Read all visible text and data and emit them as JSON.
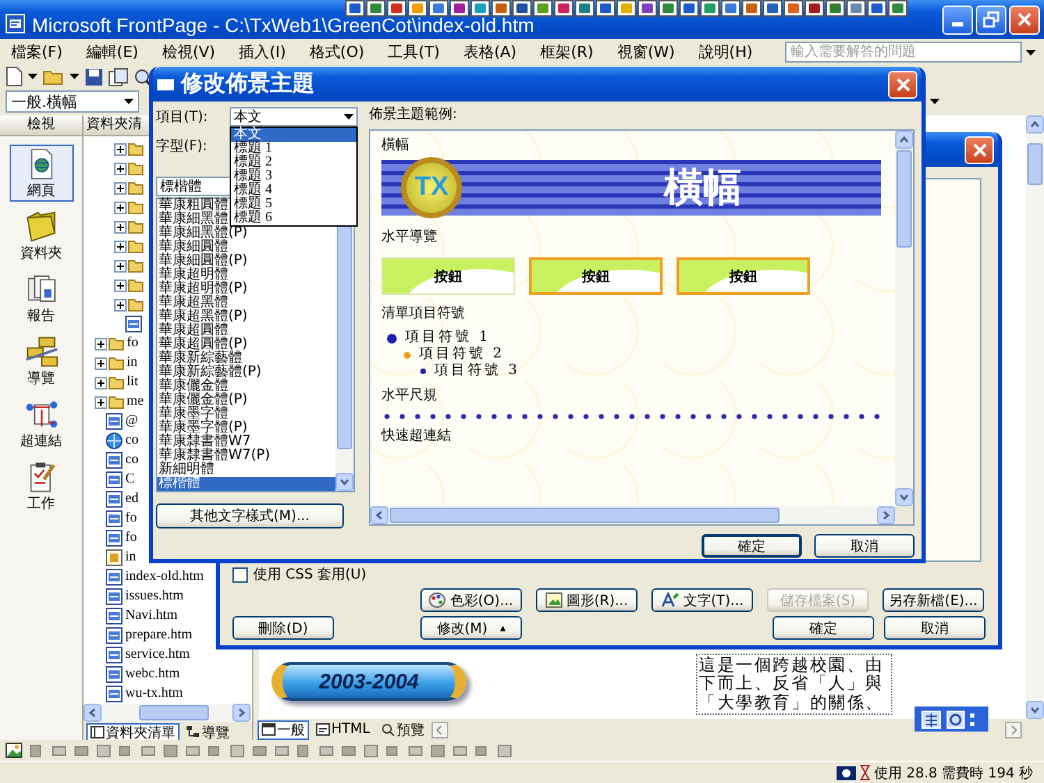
{
  "window": {
    "title": "Microsoft FrontPage - C:\\TxWeb1\\GreenCot\\index-old.htm"
  },
  "menu": [
    "檔案(F)",
    "編輯(E)",
    "檢視(V)",
    "插入(I)",
    "格式(O)",
    "工具(T)",
    "表格(A)",
    "框架(R)",
    "視窗(W)",
    "說明(H)"
  ],
  "help_box": {
    "placeholder": "輸入需要解答的問題"
  },
  "style_box": {
    "value": "一般.橫幅"
  },
  "views_bar": {
    "header": "檢視",
    "items": [
      {
        "label": "網頁",
        "kind": "page",
        "selected": true
      },
      {
        "label": "資料夾",
        "kind": "folders",
        "selected": false
      },
      {
        "label": "報告",
        "kind": "reports",
        "selected": false
      },
      {
        "label": "導覽",
        "kind": "navigation",
        "selected": false
      },
      {
        "label": "超連結",
        "kind": "hyperlinks",
        "selected": false
      },
      {
        "label": "工作",
        "kind": "tasks",
        "selected": false
      }
    ]
  },
  "folder_list": {
    "header": "資料夾清",
    "items": [
      {
        "children": [
          {
            "kind": "folder",
            "expanded": false
          },
          {
            "kind": "folder",
            "expanded": false
          },
          {
            "kind": "folder",
            "expanded": false
          },
          {
            "kind": "folder",
            "expanded": false
          },
          {
            "kind": "folder",
            "expanded": false
          },
          {
            "kind": "folder",
            "expanded": false
          },
          {
            "kind": "folder",
            "expanded": false
          },
          {
            "kind": "folder",
            "expanded": false
          },
          {
            "kind": "folder",
            "expanded": false
          },
          {
            "kind": "page"
          }
        ]
      },
      {
        "kind": "folder",
        "label": "fo",
        "expanded": false
      },
      {
        "kind": "folder",
        "label": "in",
        "expanded": false
      },
      {
        "kind": "folder",
        "label": "lit",
        "expanded": false
      },
      {
        "kind": "folder",
        "label": "me",
        "expanded": false
      },
      {
        "kind": "page",
        "label": "@"
      },
      {
        "kind": "globe",
        "label": "co"
      },
      {
        "kind": "page",
        "label": "co"
      },
      {
        "kind": "page",
        "label": "C"
      },
      {
        "kind": "page",
        "label": "ed"
      },
      {
        "kind": "page",
        "label": "fo"
      },
      {
        "kind": "page",
        "label": "fo"
      },
      {
        "kind": "script",
        "label": "in"
      },
      {
        "kind": "page",
        "label": "index-old.htm"
      },
      {
        "kind": "page",
        "label": "issues.htm"
      },
      {
        "kind": "page",
        "label": "Navi.htm"
      },
      {
        "kind": "page",
        "label": "prepare.htm"
      },
      {
        "kind": "page",
        "label": "service.htm"
      },
      {
        "kind": "page",
        "label": "webc.htm"
      },
      {
        "kind": "page",
        "label": "wu-tx.htm"
      }
    ],
    "tabs": [
      {
        "label": "資料夾清單",
        "kind": "folders",
        "selected": true
      },
      {
        "label": "導覽",
        "kind": "navigation",
        "selected": false
      }
    ]
  },
  "editor": {
    "banner_text": "2003-2004",
    "paragraph": "這是一個跨越校園、由下而上、反省「人」與「大學教育」的關係、",
    "tabs": [
      {
        "label": "一般",
        "kind": "normal",
        "selected": true
      },
      {
        "label": "HTML",
        "kind": "html",
        "selected": false
      },
      {
        "label": "預覽",
        "kind": "preview",
        "selected": false
      }
    ]
  },
  "theme_dialog": {
    "css_checkbox": {
      "label": "使用 CSS 套用(U)",
      "checked": false
    },
    "buttons": [
      {
        "label": "色彩(O)...",
        "kind": "colors",
        "disabled": false
      },
      {
        "label": "圖形(R)...",
        "kind": "graphics",
        "disabled": false
      },
      {
        "label": "文字(T)...",
        "kind": "text",
        "disabled": false
      },
      {
        "label": "儲存檔案(S)",
        "kind": "plain",
        "disabled": true
      },
      {
        "label": "另存新檔(E)...",
        "kind": "plain",
        "disabled": false
      }
    ],
    "bottom_buttons": [
      {
        "label": "刪除(D)"
      },
      {
        "label": "修改(M)",
        "indicator": "▴"
      },
      {
        "label": "確定"
      },
      {
        "label": "取消"
      }
    ]
  },
  "modify_dialog": {
    "title": "修改佈景主題",
    "item_label": "項目(T):",
    "item_select": {
      "value": "本文",
      "options": [
        {
          "label": "本文",
          "selected": true
        },
        {
          "label": "標題 1",
          "selected": false
        },
        {
          "label": "標題 2",
          "selected": false
        },
        {
          "label": "標題 3",
          "selected": false
        },
        {
          "label": "標題 4",
          "selected": false
        },
        {
          "label": "標題 5",
          "selected": false
        },
        {
          "label": "標題 6",
          "selected": false
        }
      ]
    },
    "font_label": "字型(F):",
    "font_input": {
      "value": "標楷體"
    },
    "font_list": [
      {
        "label": "華康粗圓體",
        "selected": false
      },
      {
        "label": "華康細黑體",
        "selected": false
      },
      {
        "label": "華康細黑體(P)",
        "selected": false
      },
      {
        "label": "華康細圓體",
        "selected": false
      },
      {
        "label": "華康細圓體(P)",
        "selected": false
      },
      {
        "label": "華康超明體",
        "selected": false
      },
      {
        "label": "華康超明體(P)",
        "selected": false
      },
      {
        "label": "華康超黑體",
        "selected": false
      },
      {
        "label": "華康超黑體(P)",
        "selected": false
      },
      {
        "label": "華康超圓體",
        "selected": false
      },
      {
        "label": "華康超圓體(P)",
        "selected": false
      },
      {
        "label": "華康新綜藝體",
        "selected": false
      },
      {
        "label": "華康新綜藝體(P)",
        "selected": false
      },
      {
        "label": "華康儷金體",
        "selected": false
      },
      {
        "label": "華康儷金體(P)",
        "selected": false
      },
      {
        "label": "華康墨字體",
        "selected": false
      },
      {
        "label": "華康墨字體(P)",
        "selected": false
      },
      {
        "label": "華康隸書體W7",
        "selected": false
      },
      {
        "label": "華康隸書體W7(P)",
        "selected": false
      },
      {
        "label": "新細明體",
        "selected": false
      },
      {
        "label": "標楷體",
        "selected": true
      }
    ],
    "more_button": "其他文字樣式(M)...",
    "preview_label": "佈景主題範例:",
    "preview": {
      "banner_label": "橫幅",
      "logo_text": "TX",
      "banner_text": "橫幅",
      "nav_label": "水平導覽",
      "nav_buttons": [
        {
          "label": "按鈕",
          "kind": "plain"
        },
        {
          "label": "按鈕",
          "kind": "framed"
        },
        {
          "label": "按鈕",
          "kind": "framed"
        }
      ],
      "bullets_label": "清單項目符號",
      "bullets": [
        {
          "label": "項目符號 1",
          "children": [
            {
              "label": "項目符號 2",
              "children": [
                {
                  "label": "項目符號 3"
                }
              ]
            }
          ]
        }
      ],
      "rule_label": "水平尺規",
      "links_label": "快速超連結"
    },
    "buttons": [
      "確定",
      "取消"
    ]
  },
  "status_bar": {
    "text": "使用 28.8 需費時 194 秒"
  }
}
